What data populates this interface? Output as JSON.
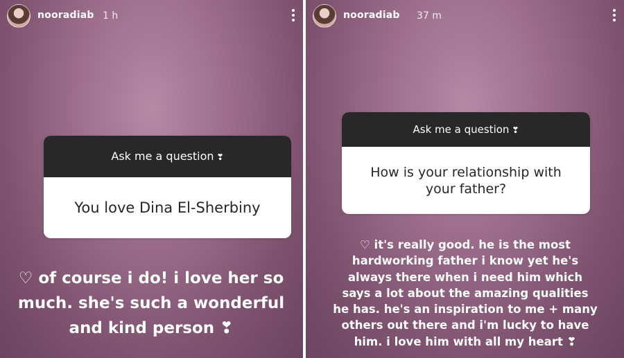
{
  "stories": [
    {
      "username": "nooradiab",
      "time": "1 h",
      "question_title": "Ask me a question",
      "question_title_emoji": "❣",
      "question_text": "You love Dina El-Sherbiny",
      "reply_lines": [
        "♡ of course i do! i love her so",
        "much. she's such a wonderful",
        "and kind person ❣"
      ]
    },
    {
      "username": "nooradiab",
      "time": "37 m",
      "question_title": "Ask me a question",
      "question_title_emoji": "❣",
      "question_text": "How is your relationship with your father?",
      "reply_lines": [
        "♡ it's really good. he is the most",
        "hardworking father i know yet he's",
        "always there when i need him which",
        "says a lot about the amazing qualities",
        "he has. he's an inspiration to me + many",
        "others out there and i'm lucky to have",
        "him. i love him with all my heart ❣"
      ]
    }
  ],
  "icons": {
    "avatar": "profile-avatar",
    "more": "more-options-icon"
  },
  "colors": {
    "story_bg": "#9d6f8d",
    "card_header": "#282828",
    "card_body": "#ffffff",
    "text_light": "#ffffff"
  }
}
